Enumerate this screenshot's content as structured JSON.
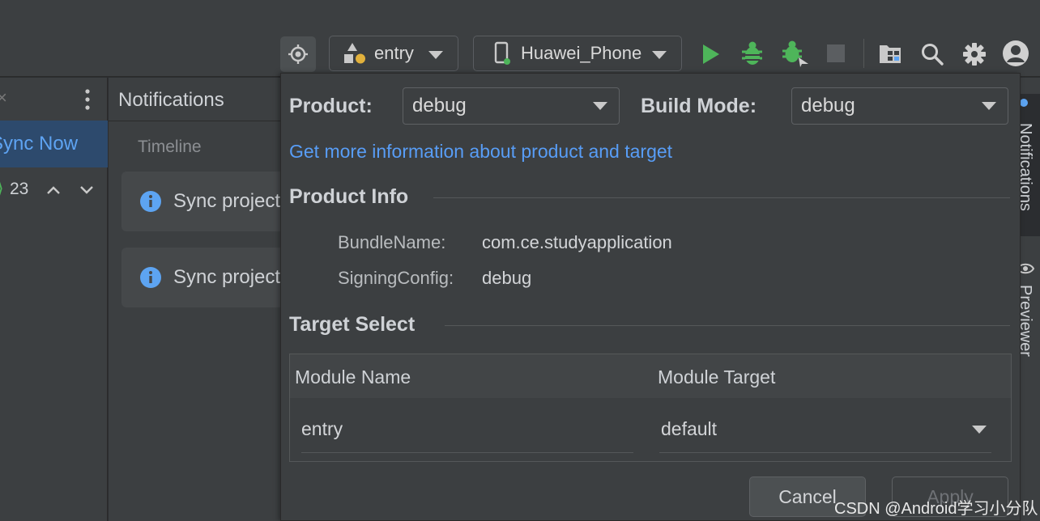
{
  "toolbar": {
    "module_selector": "entry",
    "device_selector": "Huawei_Phone"
  },
  "left_panel": {
    "sync_now": "Sync Now",
    "count": "23"
  },
  "notifications": {
    "title": "Notifications",
    "timeline": "Timeline",
    "items": [
      {
        "text": "Sync project"
      },
      {
        "text": "Sync project"
      }
    ]
  },
  "popup": {
    "product_label": "Product:",
    "product_value": "debug",
    "build_mode_label": "Build Mode:",
    "build_mode_value": "debug",
    "info_link": "Get more information about product and target",
    "product_info_title": "Product Info",
    "bundle_name_label": "BundleName:",
    "bundle_name_value": "com.ce.studyapplication",
    "signing_config_label": "SigningConfig:",
    "signing_config_value": "debug",
    "target_select_title": "Target Select",
    "table": {
      "headers": [
        "Module Name",
        "Module Target"
      ],
      "rows": [
        {
          "module_name": "entry",
          "module_target": "default"
        }
      ]
    },
    "cancel_label": "Cancel",
    "apply_label": "Apply"
  },
  "right_strip": {
    "notifications_tab": "Notifications",
    "previewer_tab": "Previewer"
  },
  "watermark": "CSDN @Android学习小分队",
  "colors": {
    "run_green": "#4eb55a",
    "link_blue": "#589df6",
    "info_blue": "#5da4f2"
  }
}
